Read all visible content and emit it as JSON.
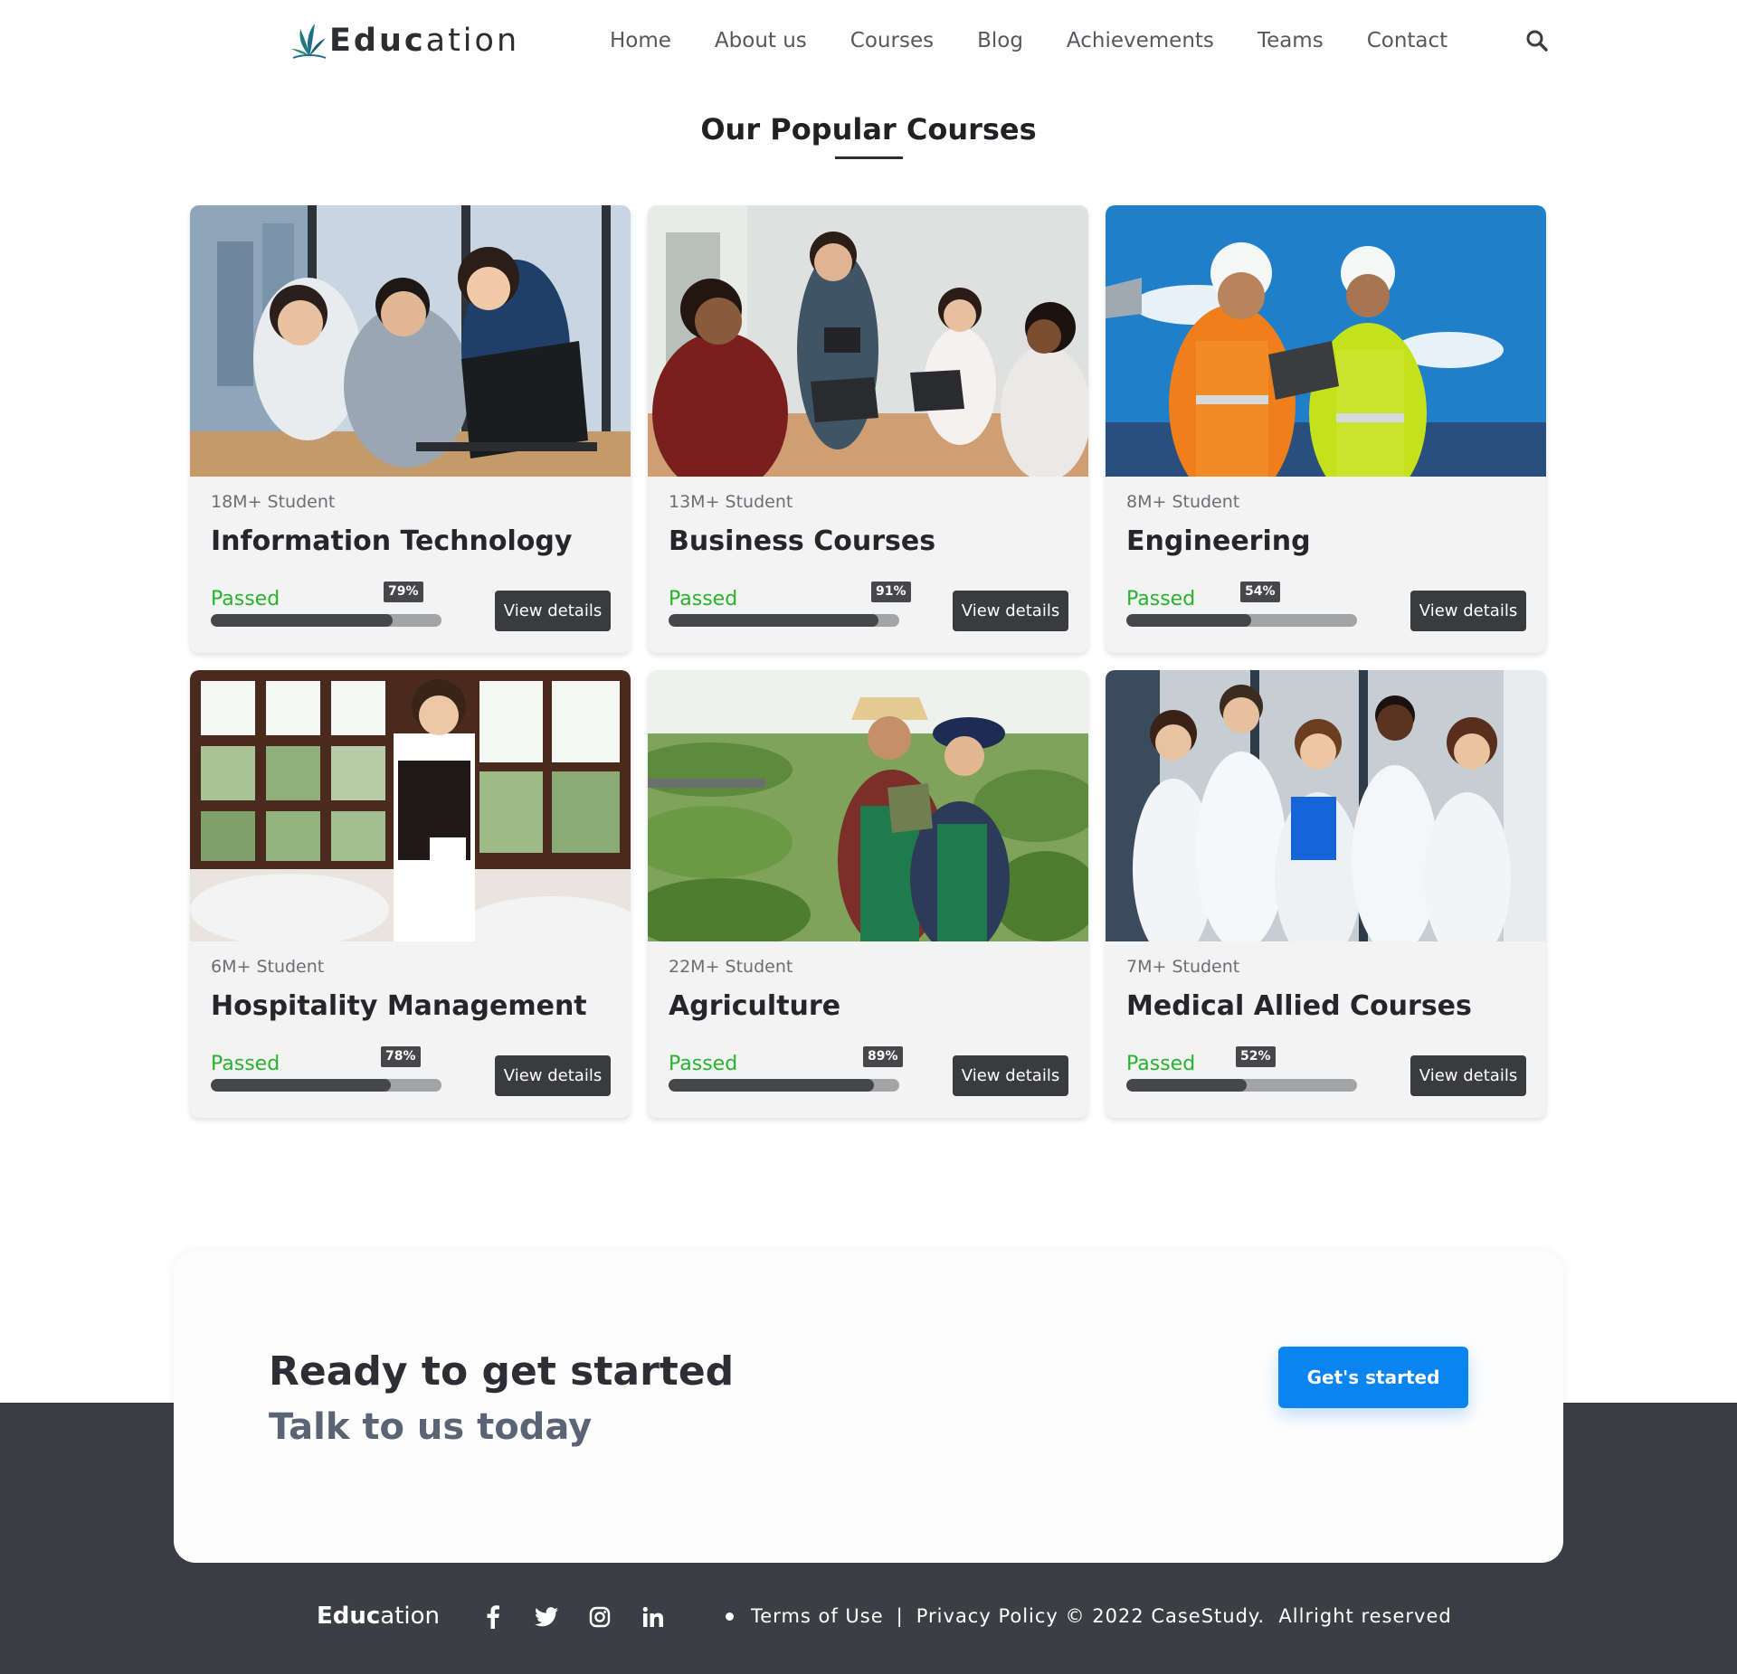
{
  "brand": {
    "bold": "Educ",
    "light": "ation"
  },
  "nav": {
    "items": [
      "Home",
      "About us",
      "Courses",
      "Blog",
      "Achievements",
      "Teams",
      "Contact"
    ]
  },
  "section": {
    "title": "Our Popular Courses"
  },
  "courses": [
    {
      "students": "18M+ Student",
      "title": "Information Technology",
      "passed_label": "Passed",
      "percent_label": "79%",
      "percent": 79,
      "button": "View details",
      "image": "office-team-laptop-photo"
    },
    {
      "students": "13M+ Student",
      "title": "Business Courses",
      "passed_label": "Passed",
      "percent_label": "91%",
      "percent": 91,
      "button": "View details",
      "image": "business-meeting-photo"
    },
    {
      "students": "8M+ Student",
      "title": "Engineering",
      "passed_label": "Passed",
      "percent_label": "54%",
      "percent": 54,
      "button": "View details",
      "image": "engineers-hardhats-photo"
    },
    {
      "students": "6M+ Student",
      "title": "Hospitality Management",
      "passed_label": "Passed",
      "percent_label": "78%",
      "percent": 78,
      "button": "View details",
      "image": "waitress-restaurant-photo"
    },
    {
      "students": "22M+ Student",
      "title": "Agriculture",
      "passed_label": "Passed",
      "percent_label": "89%",
      "percent": 89,
      "button": "View details",
      "image": "greenhouse-farmers-photo"
    },
    {
      "students": "7M+ Student",
      "title": "Medical Allied Courses",
      "passed_label": "Passed",
      "percent_label": "52%",
      "percent": 52,
      "button": "View details",
      "image": "medical-staff-photo"
    }
  ],
  "cta": {
    "heading": "Ready to get started",
    "subheading": "Talk to us today",
    "button": "Get's started"
  },
  "footer": {
    "brand": {
      "bold": "Educ",
      "light": "ation"
    },
    "socials": [
      "facebook-icon",
      "twitter-icon",
      "instagram-icon",
      "linkedin-icon"
    ],
    "terms": "Terms of Use",
    "separator": "|",
    "privacy": "Privacy Policy © 2022 CaseStudy.",
    "rights": "Allright reserved"
  },
  "colors": {
    "accent_blue": "#0a84f0",
    "passed_green": "#27b32d",
    "dark": "#3b3e43",
    "logo_teal": "#1f7a7a"
  }
}
